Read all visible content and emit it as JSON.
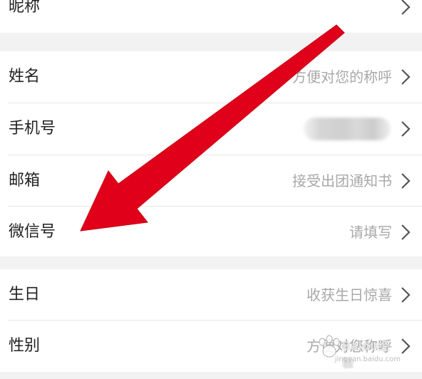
{
  "rows": [
    {
      "label": "昵称",
      "value": ""
    },
    {
      "label": "姓名",
      "value": "方便对您的称呼"
    },
    {
      "label": "手机号",
      "value": ""
    },
    {
      "label": "邮箱",
      "value": "接受出团通知书"
    },
    {
      "label": "微信号",
      "value": "请填写"
    },
    {
      "label": "生日",
      "value": "收获生日惊喜"
    },
    {
      "label": "性别",
      "value": "方便对您称呼"
    }
  ],
  "watermark": {
    "text": "Baidu经验",
    "url": "jingyan.baidu.com"
  },
  "colors": {
    "background": "#f2f2f2",
    "row": "#ffffff",
    "label": "#222222",
    "value": "#a8a8a8",
    "arrow": "#e0001a"
  },
  "icons": {
    "chevron": "chevron-right-icon",
    "annotation": "red-arrow-annotation"
  }
}
